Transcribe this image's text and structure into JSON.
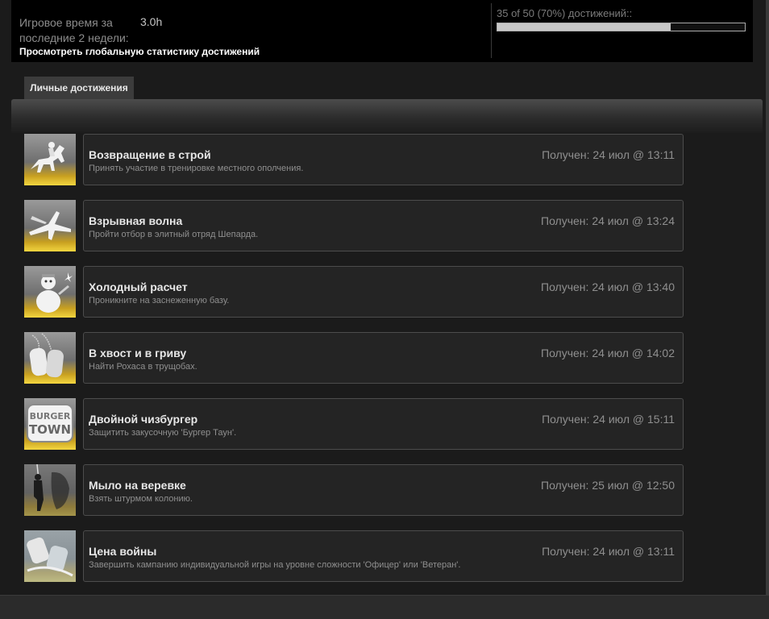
{
  "stats": {
    "playtime_label": "Игровое время за последние 2 недели:",
    "playtime_value": "3.0h",
    "global_link": "Просмотреть глобальную статистику достижений",
    "progress_text": "35 of 50 (70%) достижений::",
    "progress_fraction": 0.7
  },
  "tabs": [
    {
      "label": "Личные достижения"
    }
  ],
  "achievements": [
    {
      "title": "Возвращение в строй",
      "description": "Принять участие в тренировке местного ополчения.",
      "unlocked": "Получен: 24 июл @ 13:11",
      "icon": "horse-rider-icon"
    },
    {
      "title": "Взрывная волна",
      "description": "Пройти отбор в элитный отряд Шепарда.",
      "unlocked": "Получен: 24 июл @ 13:24",
      "icon": "fighter-jet-icon"
    },
    {
      "title": "Холодный расчет",
      "description": "Проникните на заснеженную базу.",
      "unlocked": "Получен: 24 июл @ 13:40",
      "icon": "snowman-icon"
    },
    {
      "title": "В хвост и в гриву",
      "description": "Найти Рохаса в трущобах.",
      "unlocked": "Получен: 24 июл @ 14:02",
      "icon": "dog-tags-icon"
    },
    {
      "title": "Двойной чизбургер",
      "description": "Защитить закусочную 'Бургер Таун'.",
      "unlocked": "Получен: 24 июл @ 15:11",
      "icon": "burger-town-logo-icon",
      "icon_text": [
        "BURGER",
        "TOWN"
      ]
    },
    {
      "title": "Мыло на веревке",
      "description": "Взять штурмом колонию.",
      "unlocked": "Получен: 25 июл @ 12:50",
      "icon": "hanging-figure-icon"
    },
    {
      "title": "Цена войны",
      "description": "Завершить кампанию индивидуальной игры на уровне сложности 'Офицер' или 'Ветеран'.",
      "unlocked": "Получен: 24 июл @ 13:11",
      "icon": "medals-icon"
    }
  ]
}
